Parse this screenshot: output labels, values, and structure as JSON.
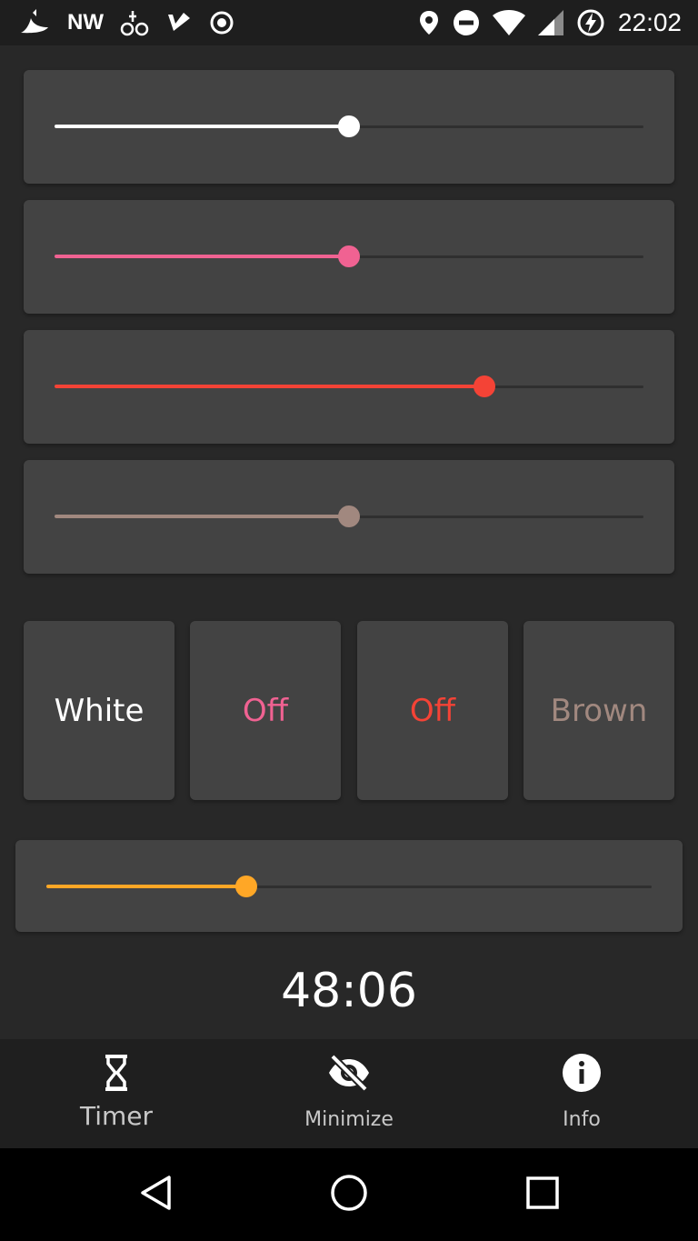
{
  "status_bar": {
    "left_text": "NW",
    "time": "22:02",
    "icons": [
      "weather-icon",
      "nw-text",
      "bike-icon",
      "check-arrow-icon",
      "record-icon",
      "location-icon",
      "do-not-disturb-icon",
      "wifi-icon",
      "signal-icon",
      "battery-charging-icon"
    ]
  },
  "sliders": [
    {
      "name": "white-noise-volume",
      "value": 0.5,
      "color": "#ffffff"
    },
    {
      "name": "pink-noise-volume",
      "value": 0.5,
      "color": "#f06292"
    },
    {
      "name": "red-noise-volume",
      "value": 0.73,
      "color": "#f44336"
    },
    {
      "name": "brown-noise-volume",
      "value": 0.5,
      "color": "#a1887f"
    }
  ],
  "buttons": [
    {
      "label": "White",
      "color": "#ffffff"
    },
    {
      "label": "Off",
      "color": "#f06292"
    },
    {
      "label": "Off",
      "color": "#f44336"
    },
    {
      "label": "Brown",
      "color": "#a1887f"
    }
  ],
  "timer_slider": {
    "value": 0.33,
    "color": "#ffa726"
  },
  "timer_display": "48:06",
  "bottom_nav": {
    "items": [
      {
        "label": "Timer",
        "icon": "hourglass-icon"
      },
      {
        "label": "Minimize",
        "icon": "eye-off-icon"
      },
      {
        "label": "Info",
        "icon": "info-icon"
      }
    ]
  },
  "system_nav": {
    "icons": [
      "back-icon",
      "home-icon",
      "recents-icon"
    ]
  }
}
